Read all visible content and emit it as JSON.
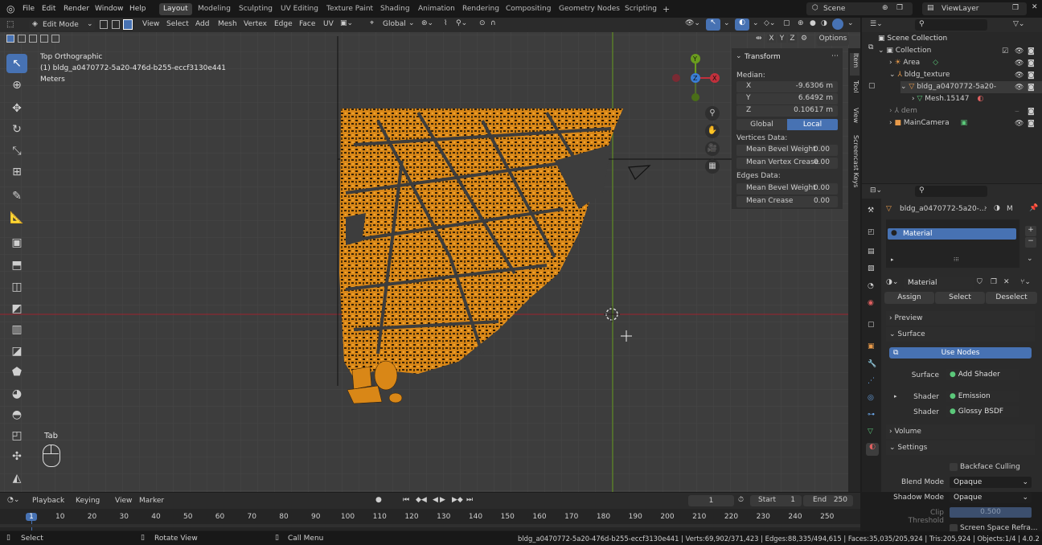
{
  "menus": [
    "File",
    "Edit",
    "Render",
    "Window",
    "Help"
  ],
  "workspaces": [
    "Layout",
    "Modeling",
    "Sculpting",
    "UV Editing",
    "Texture Paint",
    "Shading",
    "Animation",
    "Rendering",
    "Compositing",
    "Geometry Nodes",
    "Scripting"
  ],
  "scene": {
    "label": "Scene",
    "viewlayer": "ViewLayer"
  },
  "viewport_header": {
    "mode": "Edit Mode",
    "menus": [
      "View",
      "Select",
      "Add",
      "Mesh",
      "Vertex",
      "Edge",
      "Face",
      "UV"
    ],
    "orientation": "Global",
    "options": "Options",
    "axes": [
      "X",
      "Y",
      "Z"
    ]
  },
  "overlay_text": {
    "view_name": "Top Orthographic",
    "object_name": "(1) bldg_a0470772-5a20-476d-b255-eccf3130e441",
    "units": "Meters"
  },
  "keystroke": {
    "key": "Tab"
  },
  "transform_panel": {
    "title": "Transform",
    "median": "Median:",
    "x_label": "X",
    "x_value": "-9.6306 m",
    "y_label": "Y",
    "y_value": "6.6492 m",
    "z_label": "Z",
    "z_value": "0.10617 m",
    "global": "Global",
    "local": "Local",
    "vertices_data": "Vertices Data:",
    "mean_bevel_weight": "Mean Bevel Weight",
    "mean_bevel_weight_v": "0.00",
    "mean_vertex_crease": "Mean Vertex Crease",
    "mean_vertex_crease_v": "0.00",
    "edges_data": "Edges Data:",
    "mean_bevel_weight_e": "Mean Bevel Weight",
    "mean_bevel_weight_e_v": "0.00",
    "mean_crease": "Mean Crease",
    "mean_crease_v": "0.00"
  },
  "side_tabs": [
    "Item",
    "Tool",
    "View",
    "Screencast Keys"
  ],
  "outliner": {
    "root": "Scene Collection",
    "items": [
      {
        "label": "Collection"
      },
      {
        "label": "Area"
      },
      {
        "label": "bldg_texture"
      },
      {
        "label": "bldg_a0470772-5a20-"
      },
      {
        "label": "Mesh.15147"
      },
      {
        "label": "dem"
      },
      {
        "label": "MainCamera"
      }
    ]
  },
  "properties": {
    "object": "bldg_a0470772-5a20-...",
    "object_suffix": "M",
    "material_slot": "Material",
    "material_name": "Material",
    "assign": "Assign",
    "select": "Select",
    "deselect": "Deselect",
    "preview": "Preview",
    "surface": "Surface",
    "use_nodes": "Use Nodes",
    "surface_label": "Surface",
    "surface_value": "Add Shader",
    "shader1_label": "Shader",
    "shader1_value": "Emission",
    "shader2_label": "Shader",
    "shader2_value": "Glossy BSDF",
    "volume": "Volume",
    "settings": "Settings",
    "backface": "Backface Culling",
    "blend_label": "Blend Mode",
    "blend_value": "Opaque",
    "shadow_label": "Shadow Mode",
    "shadow_value": "Opaque",
    "clip_label": "Clip Threshold",
    "clip_value": "0.500",
    "ssr": "Screen Space Refra..."
  },
  "timeline": {
    "menus": [
      "Playback",
      "Keying",
      "View",
      "Marker"
    ],
    "current_frame": "1",
    "start_label": "Start",
    "start": "1",
    "end_label": "End",
    "end": "250",
    "ticks": [
      "1",
      "10",
      "20",
      "30",
      "40",
      "50",
      "60",
      "70",
      "80",
      "90",
      "100",
      "110",
      "120",
      "130",
      "140",
      "150",
      "160",
      "170",
      "180",
      "190",
      "200",
      "210",
      "220",
      "230",
      "240",
      "250"
    ]
  },
  "statusbar": {
    "select": "Select",
    "rotate": "Rotate View",
    "call_menu": "Call Menu",
    "info": "bldg_a0470772-5a20-476d-b255-eccf3130e441 | Verts:69,902/371,423 | Edges:88,335/494,615 | Faces:35,035/205,924 | Tris:205,924 | Objects:1/4 | 4.0.2"
  },
  "colors": {
    "accent": "#4772b3",
    "mesh": "#e8921a",
    "x_axis": "#c2303c",
    "y_axis": "#6a9c1e",
    "z_axis": "#3a7ed6"
  }
}
